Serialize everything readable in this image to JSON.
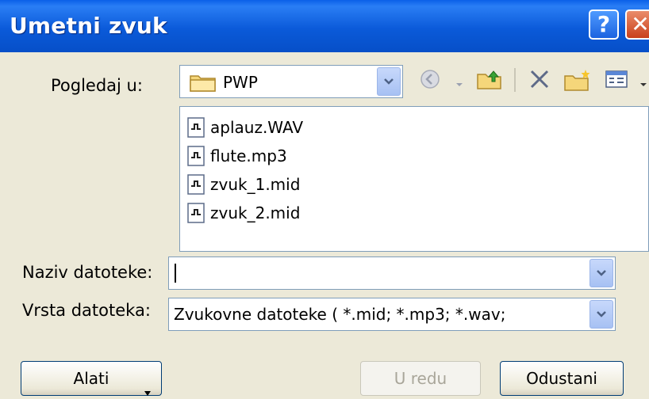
{
  "dialog": {
    "title": "Umetni zvuk",
    "help_label": "?",
    "close_label": "✕"
  },
  "lookin": {
    "label": "Pogledaj u:",
    "value": "PWP"
  },
  "files": [
    {
      "name": "aplauz.WAV"
    },
    {
      "name": "flute.mp3"
    },
    {
      "name": "zvuk_1.mid"
    },
    {
      "name": "zvuk_2.mid"
    }
  ],
  "filename": {
    "label": "Naziv datoteke:",
    "value": ""
  },
  "filetype": {
    "label": "Vrsta datoteka:",
    "value": "Zvukovne datoteke ( *.mid; *.mp3; *.wav;"
  },
  "buttons": {
    "tools": "Alati",
    "ok": "U redu",
    "cancel": "Odustani"
  },
  "colors": {
    "titlebar": "#0b5ad9",
    "dialog_bg": "#ece9d8",
    "border": "#7f9db9"
  }
}
